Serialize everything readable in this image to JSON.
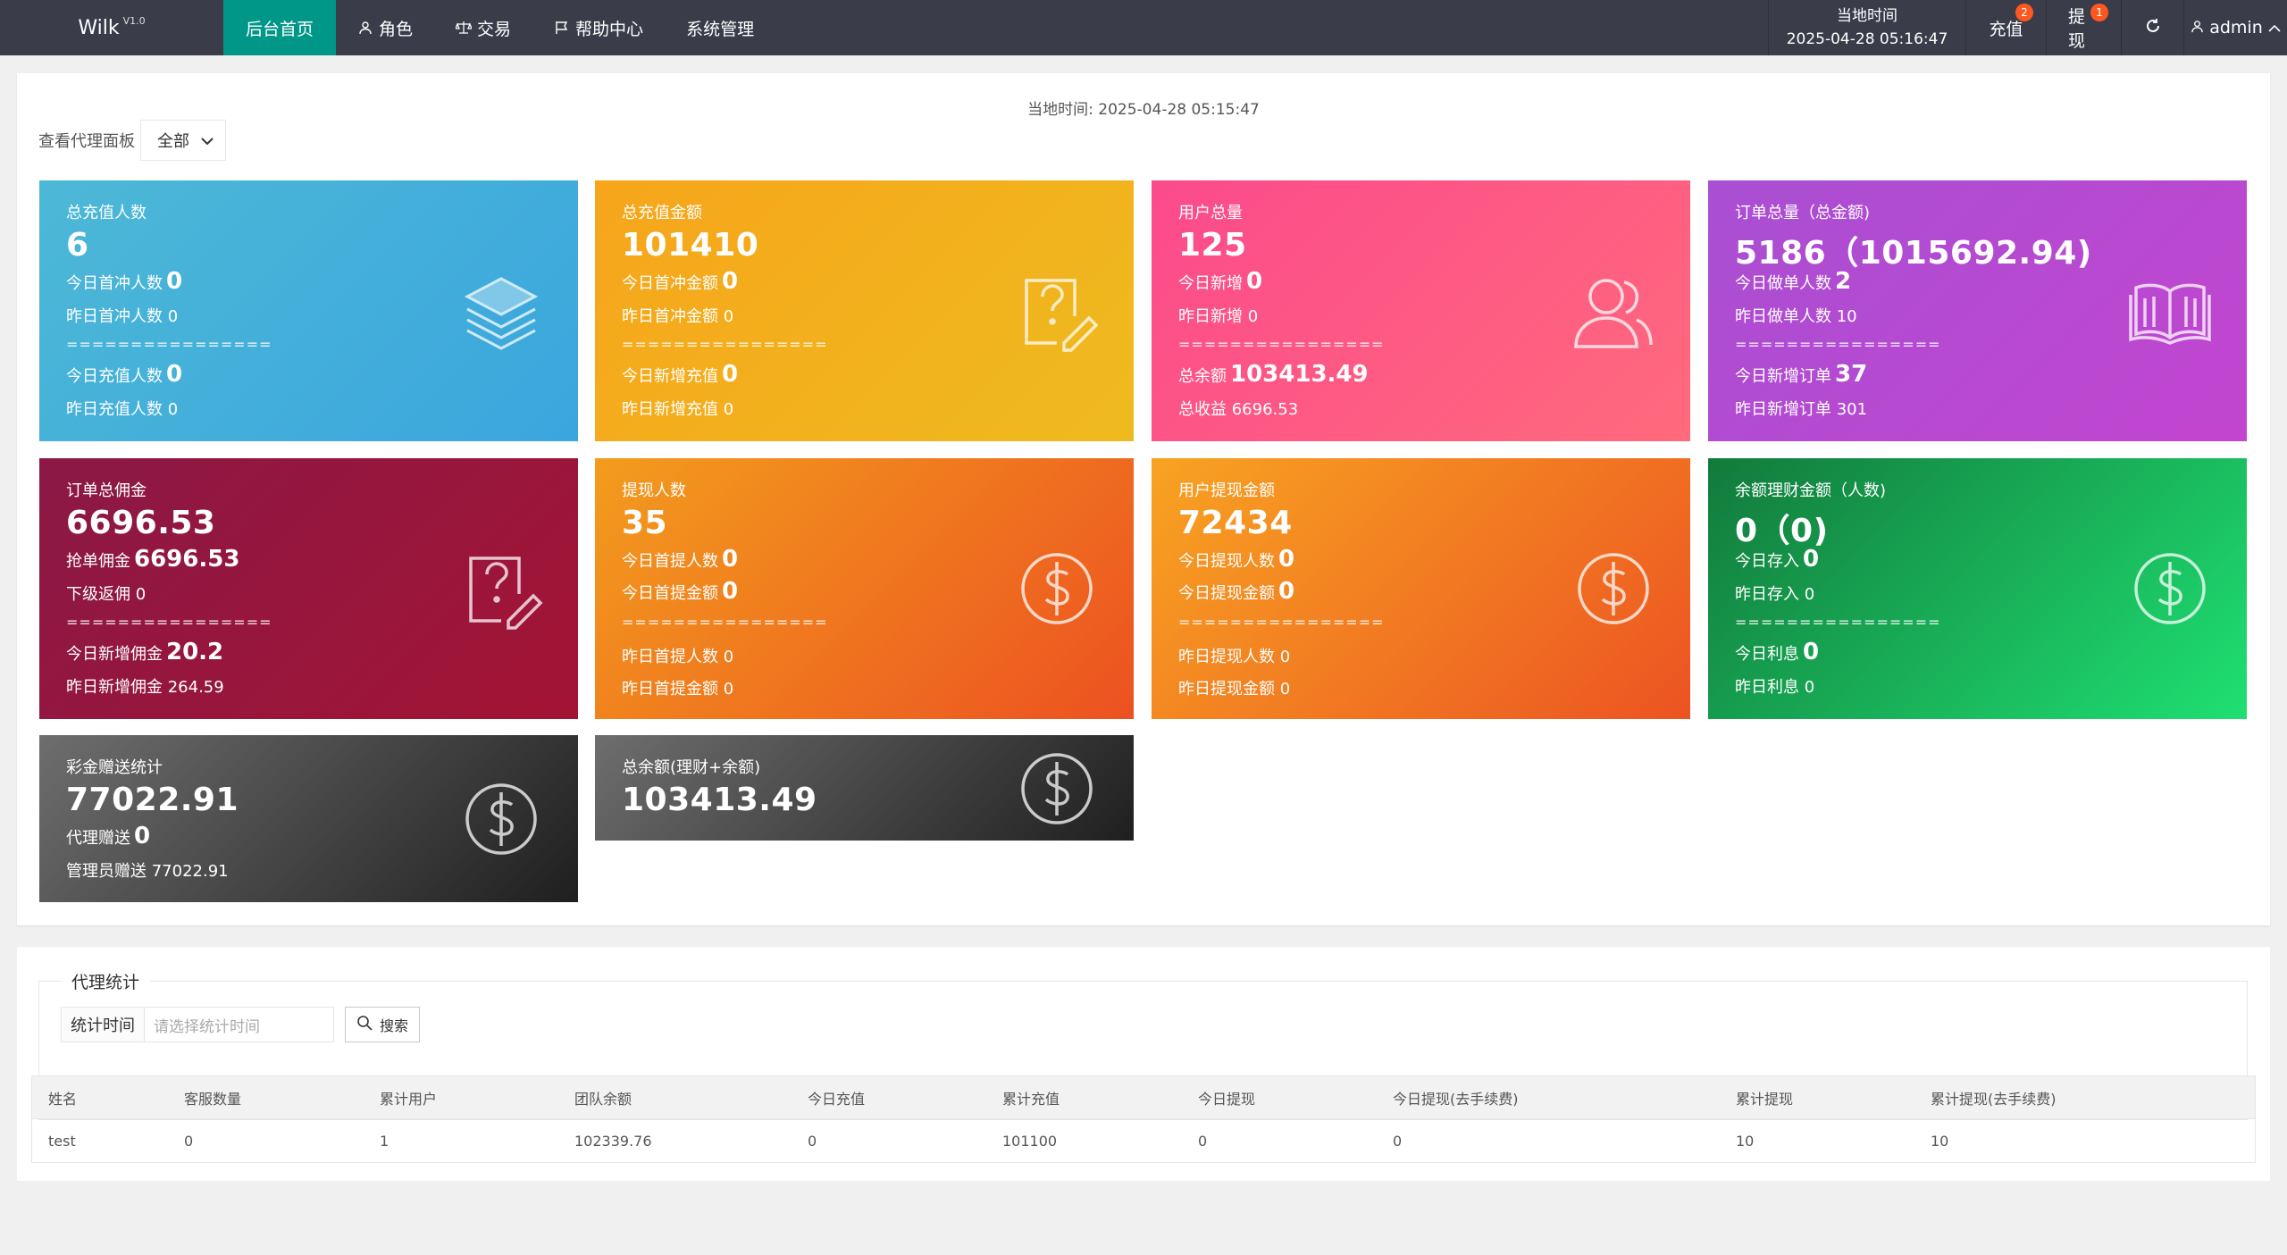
{
  "topbar": {
    "brand": "Wilk",
    "version": "V1.0",
    "nav": [
      {
        "label": "后台首页",
        "icon": "",
        "active": true
      },
      {
        "label": "角色",
        "icon": "user-icon"
      },
      {
        "label": "交易",
        "icon": "scale-icon"
      },
      {
        "label": "帮助中心",
        "icon": "flag-icon"
      },
      {
        "label": "系统管理",
        "icon": ""
      }
    ],
    "local_time_label": "当地时间",
    "local_time_value": "2025-04-28 05:16:47",
    "recharge_label": "充值",
    "recharge_badge": "2",
    "withdraw_label": "提现",
    "withdraw_badge": "1",
    "admin_label": "admin"
  },
  "page": {
    "time_text": "当地时间:   2025-04-28 05:15:47",
    "filter_label": "查看代理面板",
    "filter_value": "全部"
  },
  "cards": {
    "c1": {
      "title": "总充值人数",
      "big": "6",
      "l1": "今日首冲人数",
      "l1v": "0",
      "l2": "昨日首冲人数 0",
      "sep": "================",
      "l3": "今日充值人数",
      "l3v": "0",
      "l4": "昨日充值人数 0",
      "icon": "layers-icon"
    },
    "c2": {
      "title": "总充值金额",
      "big": "101410",
      "l1": "今日首冲金额",
      "l1v": "0",
      "l2": "昨日首冲金额 0",
      "sep": "================",
      "l3": "今日新增充值",
      "l3v": "0",
      "l4": "昨日新增充值 0",
      "icon": "question-edit-icon"
    },
    "c3": {
      "title": "用户总量",
      "big": "125",
      "l1": "今日新增",
      "l1v": "0",
      "l2": "昨日新增 0",
      "sep": "================",
      "l3": "总余额",
      "l3v": "103413.49",
      "l4": "总收益 6696.53",
      "icon": "users-icon"
    },
    "c4": {
      "title": "订单总量（总金额)",
      "big": "5186（1015692.94)",
      "l1": "今日做单人数",
      "l1v": "2",
      "l2": "昨日做单人数 10",
      "sep": "================",
      "l3": "今日新增订单",
      "l3v": "37",
      "l4": "昨日新增订单 301",
      "icon": "book-icon"
    },
    "c5": {
      "title": "订单总佣金",
      "big": "6696.53",
      "l1": "抢单佣金",
      "l1v": "6696.53",
      "l2": "下级返佣 0",
      "sep": "================",
      "l3": "今日新增佣金",
      "l3v": "20.2",
      "l4": "昨日新增佣金 264.59",
      "icon": "question-edit-icon"
    },
    "c6": {
      "title": "提现人数",
      "big": "35",
      "l1": "今日首提人数",
      "l1v": "0",
      "l2": "今日首提金额",
      "l2v": "0",
      "sep": "================",
      "l3": "昨日首提人数 0",
      "l4": "昨日首提金额 0",
      "icon": "dollar-icon"
    },
    "c7": {
      "title": "用户提现金额",
      "big": "72434",
      "l1": "今日提现人数",
      "l1v": "0",
      "l2": "今日提现金额",
      "l2v": "0",
      "sep": "================",
      "l3": "昨日提现人数 0",
      "l4": "昨日提现金额 0",
      "icon": "dollar-icon"
    },
    "c8": {
      "title": "余额理财金额（人数)",
      "big": "0（0)",
      "l1": "今日存入",
      "l1v": "0",
      "l2": "昨日存入 0",
      "sep": "================",
      "l3": "今日利息",
      "l3v": "0",
      "l4": "昨日利息 0",
      "icon": "dollar-icon"
    },
    "c9": {
      "title": "彩金赠送统计",
      "big": "77022.91",
      "l1": "代理赠送",
      "l1v": "0",
      "l2": "管理员赠送 77022.91",
      "icon": "dollar-icon"
    },
    "c10": {
      "title": "总余额(理财+余额)",
      "big": "103413.49",
      "icon": "dollar-icon"
    }
  },
  "agent": {
    "legend": "代理统计",
    "time_label": "统计时间",
    "time_placeholder": "请选择统计时间",
    "search_label": "搜索",
    "columns": [
      "姓名",
      "客服数量",
      "累计用户",
      "团队余额",
      "今日充值",
      "累计充值",
      "今日提现",
      "今日提现(去手续费)",
      "累计提现",
      "累计提现(去手续费)"
    ],
    "rows": [
      [
        "test",
        "0",
        "1",
        "102339.76",
        "0",
        "101100",
        "0",
        "0",
        "10",
        "10"
      ]
    ]
  }
}
